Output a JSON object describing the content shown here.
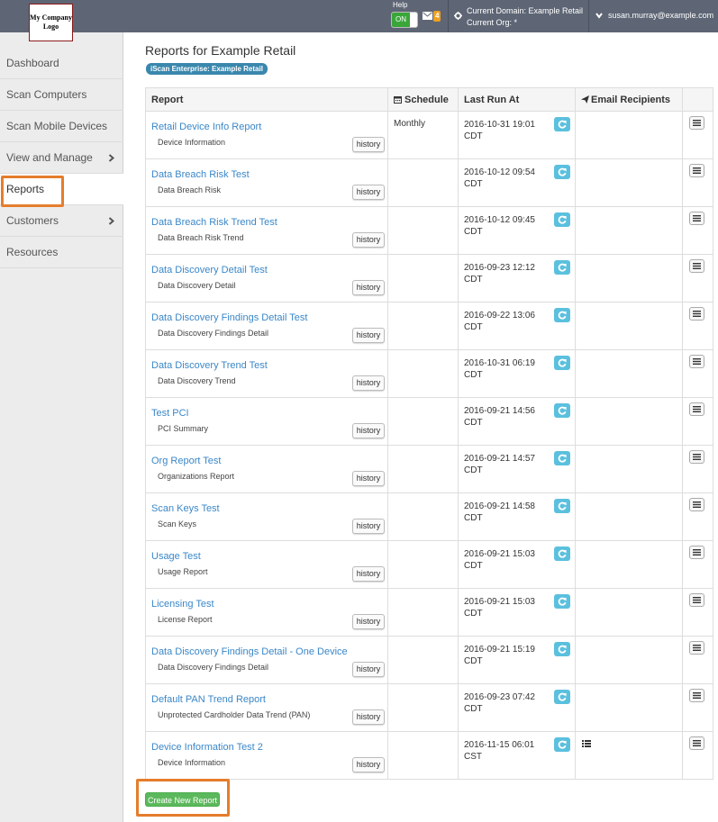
{
  "header": {
    "logo_text": "My Company Logo",
    "help_label": "Help",
    "toggle_label": "ON",
    "mail_count": "4",
    "current_domain": "Current Domain: Example Retail",
    "current_org": "Current Org: *",
    "user_email": "susan.murray@example.com"
  },
  "sidebar": {
    "items": [
      {
        "label": "Dashboard"
      },
      {
        "label": "Scan Computers"
      },
      {
        "label": "Scan Mobile Devices"
      },
      {
        "label": "View and Manage"
      },
      {
        "label": "Reports"
      },
      {
        "label": "Customers"
      },
      {
        "label": "Resources"
      }
    ]
  },
  "main": {
    "title": "Reports for Example Retail",
    "badge": "iScan Enterprise: Example Retail",
    "columns": {
      "report": "Report",
      "schedule": "Schedule",
      "last_run": "Last Run At",
      "email": "Email Recipients"
    },
    "history_label": "history",
    "rows": [
      {
        "name": "Retail Device Info Report",
        "type": "Device Information",
        "schedule": "Monthly",
        "last_run": "2016-10-31 19:01 CDT",
        "has_recipients": false
      },
      {
        "name": "Data Breach Risk Test",
        "type": "Data Breach Risk",
        "schedule": "",
        "last_run": "2016-10-12 09:54 CDT",
        "has_recipients": false
      },
      {
        "name": "Data Breach Risk Trend Test",
        "type": "Data Breach Risk Trend",
        "schedule": "",
        "last_run": "2016-10-12 09:45 CDT",
        "has_recipients": false
      },
      {
        "name": "Data Discovery Detail Test",
        "type": "Data Discovery Detail",
        "schedule": "",
        "last_run": "2016-09-23 12:12 CDT",
        "has_recipients": false
      },
      {
        "name": "Data Discovery Findings Detail Test",
        "type": "Data Discovery Findings Detail",
        "schedule": "",
        "last_run": "2016-09-22 13:06 CDT",
        "has_recipients": false
      },
      {
        "name": "Data Discovery Trend Test",
        "type": "Data Discovery Trend",
        "schedule": "",
        "last_run": "2016-10-31 06:19 CDT",
        "has_recipients": false
      },
      {
        "name": "Test PCI",
        "type": "PCI Summary",
        "schedule": "",
        "last_run": "2016-09-21 14:56 CDT",
        "has_recipients": false
      },
      {
        "name": "Org Report Test",
        "type": "Organizations Report",
        "schedule": "",
        "last_run": "2016-09-21 14:57 CDT",
        "has_recipients": false
      },
      {
        "name": "Scan Keys Test",
        "type": "Scan Keys",
        "schedule": "",
        "last_run": "2016-09-21 14:58 CDT",
        "has_recipients": false
      },
      {
        "name": "Usage Test",
        "type": "Usage Report",
        "schedule": "",
        "last_run": "2016-09-21 15:03 CDT",
        "has_recipients": false
      },
      {
        "name": "Licensing Test",
        "type": "License Report",
        "schedule": "",
        "last_run": "2016-09-21 15:03 CDT",
        "has_recipients": false
      },
      {
        "name": "Data Discovery Findings Detail - One Device",
        "type": "Data Discovery Findings Detail",
        "schedule": "",
        "last_run": "2016-09-21 15:19 CDT",
        "has_recipients": false
      },
      {
        "name": "Default PAN Trend Report",
        "type": "Unprotected Cardholder Data Trend (PAN)",
        "schedule": "",
        "last_run": "2016-09-23 07:42 CDT",
        "has_recipients": false
      },
      {
        "name": "Device Information Test 2",
        "type": "Device Information",
        "schedule": "",
        "last_run": "2016-11-15 06:01 CST",
        "has_recipients": true
      }
    ],
    "create_button": "Create New Report"
  },
  "colors": {
    "topbar": "#5e6675",
    "link": "#3a87c8",
    "badge": "#3a87ad",
    "refresh": "#5bc0de",
    "create": "#5cb85c",
    "highlight": "#e57d2c"
  }
}
